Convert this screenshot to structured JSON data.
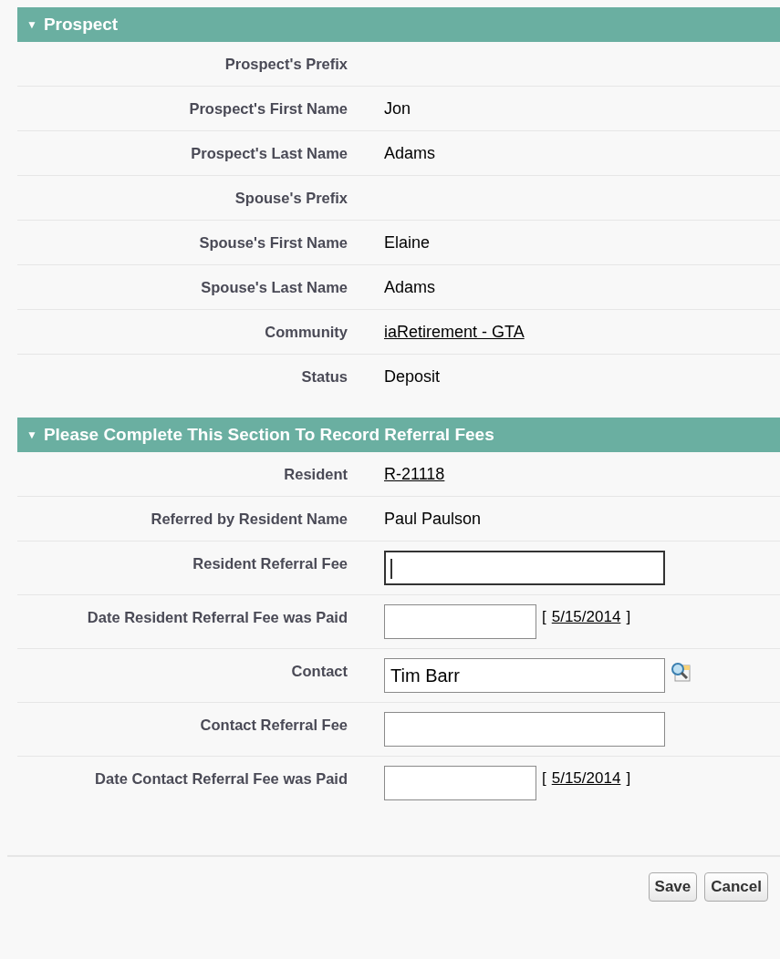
{
  "sections": [
    {
      "title": "Prospect",
      "expanded": true,
      "toggle": "▼",
      "rows": [
        {
          "label": "Prospect's Prefix",
          "kind": "text"
        },
        {
          "label": "Prospect's First Name",
          "kind": "text",
          "value": "Jon"
        },
        {
          "label": "Prospect's Last Name",
          "kind": "text",
          "value": "Adams"
        },
        {
          "label": "Spouse's Prefix",
          "kind": "text"
        },
        {
          "label": "Spouse's First Name",
          "kind": "text",
          "value": "Elaine"
        },
        {
          "label": "Spouse's Last Name",
          "kind": "text",
          "value": "Adams"
        },
        {
          "label": "Community",
          "kind": "link",
          "value": "iaRetirement - GTA"
        },
        {
          "label": "Status",
          "kind": "text",
          "value": "Deposit"
        }
      ]
    },
    {
      "title": "Please Complete This Section To Record Referral Fees",
      "expanded": true,
      "toggle": "▼",
      "rows": [
        {
          "label": "Resident",
          "kind": "link",
          "value": "R-21118"
        },
        {
          "label": "Referred by Resident Name",
          "kind": "text",
          "value": "Paul Paulson"
        },
        {
          "label": "Resident Referral Fee",
          "kind": "input",
          "focused": true
        },
        {
          "label": "Date Resident Referral Fee was Paid",
          "kind": "date",
          "date_open": "[",
          "date": "5/15/2014",
          "date_close": "]"
        },
        {
          "label": "Contact",
          "kind": "lookup",
          "value": "Tim Barr"
        },
        {
          "label": "Contact Referral Fee",
          "kind": "input",
          "focused": false
        },
        {
          "label": "Date Contact Referral Fee was Paid",
          "kind": "date",
          "date_open": "[",
          "date": "5/15/2014",
          "date_close": "]"
        }
      ]
    }
  ],
  "buttons": [
    "Save",
    "Cancel"
  ]
}
